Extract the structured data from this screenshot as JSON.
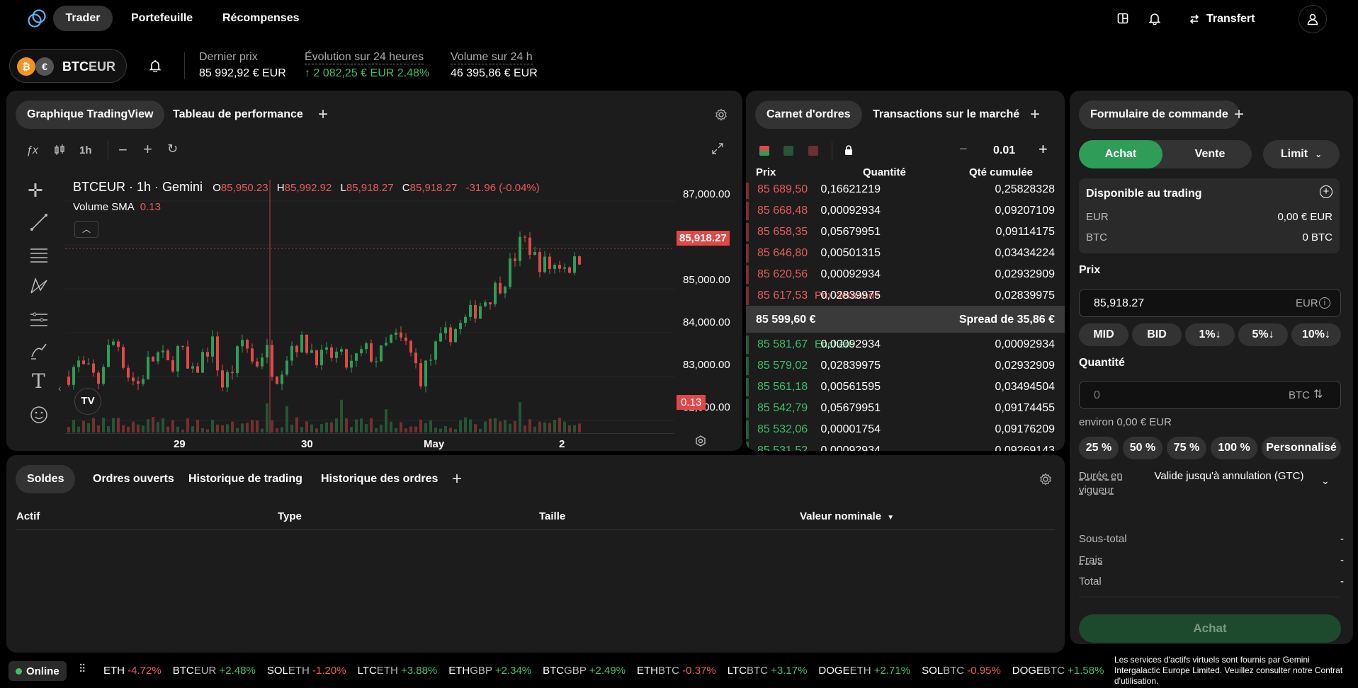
{
  "nav": {
    "items": [
      "Trader",
      "Portefeuille",
      "Récompenses"
    ],
    "transfer": "Transfert"
  },
  "market": {
    "symbol_base": "BTC",
    "symbol_quote": "EUR",
    "last_price_label": "Dernier prix",
    "last_price": "85 992,92 € EUR",
    "change_label": "Évolution sur 24 heures",
    "change": "↑ 2 082,25 € EUR 2.48%",
    "volume_label": "Volume sur 24 h",
    "volume": "46 395,86 € EUR"
  },
  "chart_panel": {
    "tabs": [
      "Graphique TradingView",
      "Tableau de performance"
    ],
    "interval": "1h",
    "legend_symbol": "BTCEUR · 1h · Gemini",
    "o_label": "O",
    "o": "85,950.23",
    "h_label": "H",
    "h": "85,992.92",
    "l_label": "L",
    "l": "85,918.27",
    "c_label": "C",
    "c": "85,918.27",
    "chg": "-31.96 (-0.04%)",
    "volume_label": "Volume SMA",
    "volume_val": "0.13",
    "price_tag": "85,918.27",
    "vol_tag": "0.13",
    "colors": {
      "up": "#2e9d57",
      "down": "#e04848"
    }
  },
  "chart_data": {
    "type": "candlestick",
    "y_ticks": [
      "87,000.00",
      "85,000.00",
      "84,000.00",
      "83,000.00",
      "82,000.00"
    ],
    "x_ticks": [
      "29",
      "30",
      "May",
      "2"
    ],
    "ylim": [
      82000,
      87000
    ],
    "last_price": 85918.27
  },
  "orderbook": {
    "tabs": [
      "Carnet d'ordres",
      "Transactions sur le marché"
    ],
    "tick": "0.01",
    "headers": [
      "Prix",
      "Quantité",
      "Qté cumulée"
    ],
    "asks": [
      {
        "price": "85 689,50",
        "qty": "0,16621219",
        "cum": "0,25828328"
      },
      {
        "price": "85 668,48",
        "qty": "0,00092934",
        "cum": "0,09207109"
      },
      {
        "price": "85 658,35",
        "qty": "0,05679951",
        "cum": "0,09114175"
      },
      {
        "price": "85 646,80",
        "qty": "0,00501315",
        "cum": "0,03434224"
      },
      {
        "price": "85 620,56",
        "qty": "0,00092934",
        "cum": "0,02932909"
      },
      {
        "price": "85 617,53",
        "qty": "0,02839975",
        "cum": "0,02839975",
        "tag": "Prix demandé"
      }
    ],
    "mid_price": "85 599,60 €",
    "spread": "Spread de 35,86 €",
    "bids": [
      {
        "price": "85 581,67",
        "qty": "0,00092934",
        "cum": "0,00092934",
        "tag": "Enchère"
      },
      {
        "price": "85 579,02",
        "qty": "0,02839975",
        "cum": "0,02932909"
      },
      {
        "price": "85 561,18",
        "qty": "0,00561595",
        "cum": "0,03494504"
      },
      {
        "price": "85 542,79",
        "qty": "0,05679951",
        "cum": "0,09174455"
      },
      {
        "price": "85 532,06",
        "qty": "0,00001754",
        "cum": "0,09176209"
      },
      {
        "price": "85 531,52",
        "qty": "0,00092934",
        "cum": "0,09269143"
      }
    ]
  },
  "order_form": {
    "tab": "Formulaire de commande",
    "buy": "Achat",
    "sell": "Vente",
    "type": "Limit",
    "available_label": "Disponible au trading",
    "eur_label": "EUR",
    "eur_val": "0,00 € EUR",
    "btc_label": "BTC",
    "btc_val": "0 BTC",
    "price_label": "Prix",
    "price_val": "85,918.27",
    "price_unit": "EUR",
    "price_buttons": [
      "MID",
      "BID",
      "1%↓",
      "5%↓",
      "10%↓"
    ],
    "qty_label": "Quantité",
    "qty_placeholder": "0",
    "qty_unit": "BTC",
    "approx": "environ 0,00 € EUR",
    "pct_buttons": [
      "25 %",
      "50 %",
      "75 %",
      "100 %",
      "Personnalisé"
    ],
    "tif_label": "Durée en vigueur",
    "tif_val": "Valide jusqu'à annulation (GTC)",
    "subtotal_label": "Sous-total",
    "subtotal_val": "-",
    "fees_label": "Frais",
    "fees_val": "-",
    "total_label": "Total",
    "total_val": "-",
    "submit": "Achat"
  },
  "bottom_panel": {
    "tabs": [
      "Soldes",
      "Ordres ouverts",
      "Historique de trading",
      "Historique des ordres"
    ],
    "headers": [
      "Actif",
      "Type",
      "Taille",
      "Valeur nominale"
    ]
  },
  "footer": {
    "status": "Online",
    "tickers": [
      {
        "base": "ETH",
        "quote": "",
        "chg": "-4.72%",
        "dir": "down"
      },
      {
        "base": "BTC",
        "quote": "EUR",
        "chg": "+2.48%",
        "dir": "up"
      },
      {
        "base": "SOL",
        "quote": "ETH",
        "chg": "-1.20%",
        "dir": "down"
      },
      {
        "base": "LTC",
        "quote": "ETH",
        "chg": "+3.88%",
        "dir": "up"
      },
      {
        "base": "ETH",
        "quote": "GBP",
        "chg": "+2.34%",
        "dir": "up"
      },
      {
        "base": "BTC",
        "quote": "GBP",
        "chg": "+2.49%",
        "dir": "up"
      },
      {
        "base": "ETH",
        "quote": "BTC",
        "chg": "-0.37%",
        "dir": "down"
      },
      {
        "base": "LTC",
        "quote": "BTC",
        "chg": "+3.17%",
        "dir": "up"
      },
      {
        "base": "DOGE",
        "quote": "ETH",
        "chg": "+2.71%",
        "dir": "up"
      },
      {
        "base": "SOL",
        "quote": "BTC",
        "chg": "-0.95%",
        "dir": "down"
      },
      {
        "base": "DOGE",
        "quote": "BTC",
        "chg": "+1.58%",
        "dir": "up"
      }
    ],
    "disclaimer": "Les services d'actifs virtuels sont fournis par Gemini Intergalactic Europe Limited. Veuillez consulter notre Contrat d'utilisation."
  }
}
